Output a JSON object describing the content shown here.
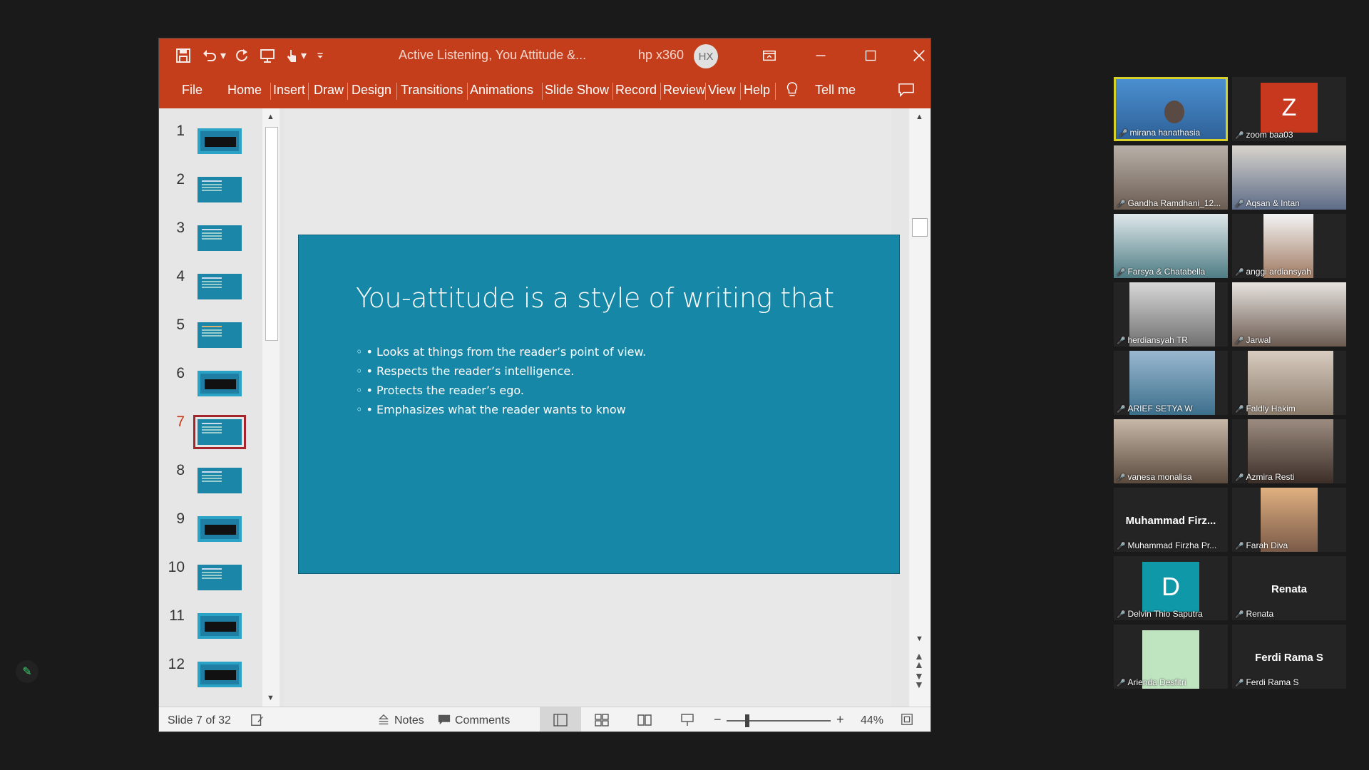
{
  "ppt": {
    "doc_title": "Active Listening, You Attitude &...",
    "user_name": "hp x360",
    "user_initials": "HX",
    "tabs": [
      "File",
      "Home",
      "Insert",
      "Draw",
      "Design",
      "Transitions",
      "Animations",
      "Slide Show",
      "Record",
      "Review",
      "View",
      "Help"
    ],
    "tell_me": "Tell me",
    "slide_numbers": [
      "1",
      "2",
      "3",
      "4",
      "5",
      "6",
      "7",
      "8",
      "9",
      "10",
      "11",
      "12"
    ],
    "current_slide": "7",
    "slide": {
      "title": "You-attitude is a style of writing that",
      "bullets": [
        "• Looks at things from the reader’s point of view.",
        "• Respects the reader’s intelligence.",
        "• Protects the reader’s ego.",
        "• Emphasizes what the reader wants to know"
      ]
    },
    "status": {
      "slide_count": "Slide 7 of 32",
      "notes": "Notes",
      "comments": "Comments",
      "zoom": "44%",
      "zoom_level": 44
    }
  },
  "zoom_gallery": {
    "tiles": [
      {
        "name": "mirana hanathasia",
        "type": "video",
        "color": "#3b7fc4",
        "active": true
      },
      {
        "name": "zoom baa03",
        "type": "letter",
        "letter": "Z",
        "color": "#c8381e"
      },
      {
        "name": "Gandha Ramdhani_12...",
        "type": "video",
        "color": "#7a6b62"
      },
      {
        "name": "Aqsan & Intan",
        "type": "video",
        "color": "#8f8c86"
      },
      {
        "name": "Farsya & Chatabella",
        "type": "video",
        "color": "#6e7f7a"
      },
      {
        "name": "anggi ardiansyah",
        "type": "video",
        "color": "#c9b8a8"
      },
      {
        "name": "herdiansyah TR",
        "type": "video",
        "color": "#9a9a9a"
      },
      {
        "name": "Jarwal",
        "type": "video",
        "color": "#8a7b72"
      },
      {
        "name": "ARIEF SETYA W",
        "type": "video",
        "color": "#4d7c98"
      },
      {
        "name": "Faldly Hakim",
        "type": "video",
        "color": "#a89a8c"
      },
      {
        "name": "vanesa monalisa",
        "type": "video",
        "color": "#7d6c5c"
      },
      {
        "name": "Azmira Resti",
        "type": "video",
        "color": "#6b5a4e"
      },
      {
        "name": "Muhammad Firzha Pr...",
        "type": "text",
        "big": "Muhammad  Firz..."
      },
      {
        "name": "Farah Diva",
        "type": "video",
        "color": "#8c7060"
      },
      {
        "name": "Delvin Thio Saputra",
        "type": "letter",
        "letter": "D",
        "color": "#0e98a8"
      },
      {
        "name": "Renata",
        "type": "text",
        "big": "Renata"
      },
      {
        "name": "Arienda Desfitri",
        "type": "block",
        "color": "#bfe4c0"
      },
      {
        "name": "Ferdi Rama S",
        "type": "text",
        "big": "Ferdi Rama S"
      }
    ]
  },
  "colors": {
    "ppt_accent": "#c43e1c",
    "slide_bg": "#1687a7",
    "zoom_highlight": "#d8d02a"
  }
}
